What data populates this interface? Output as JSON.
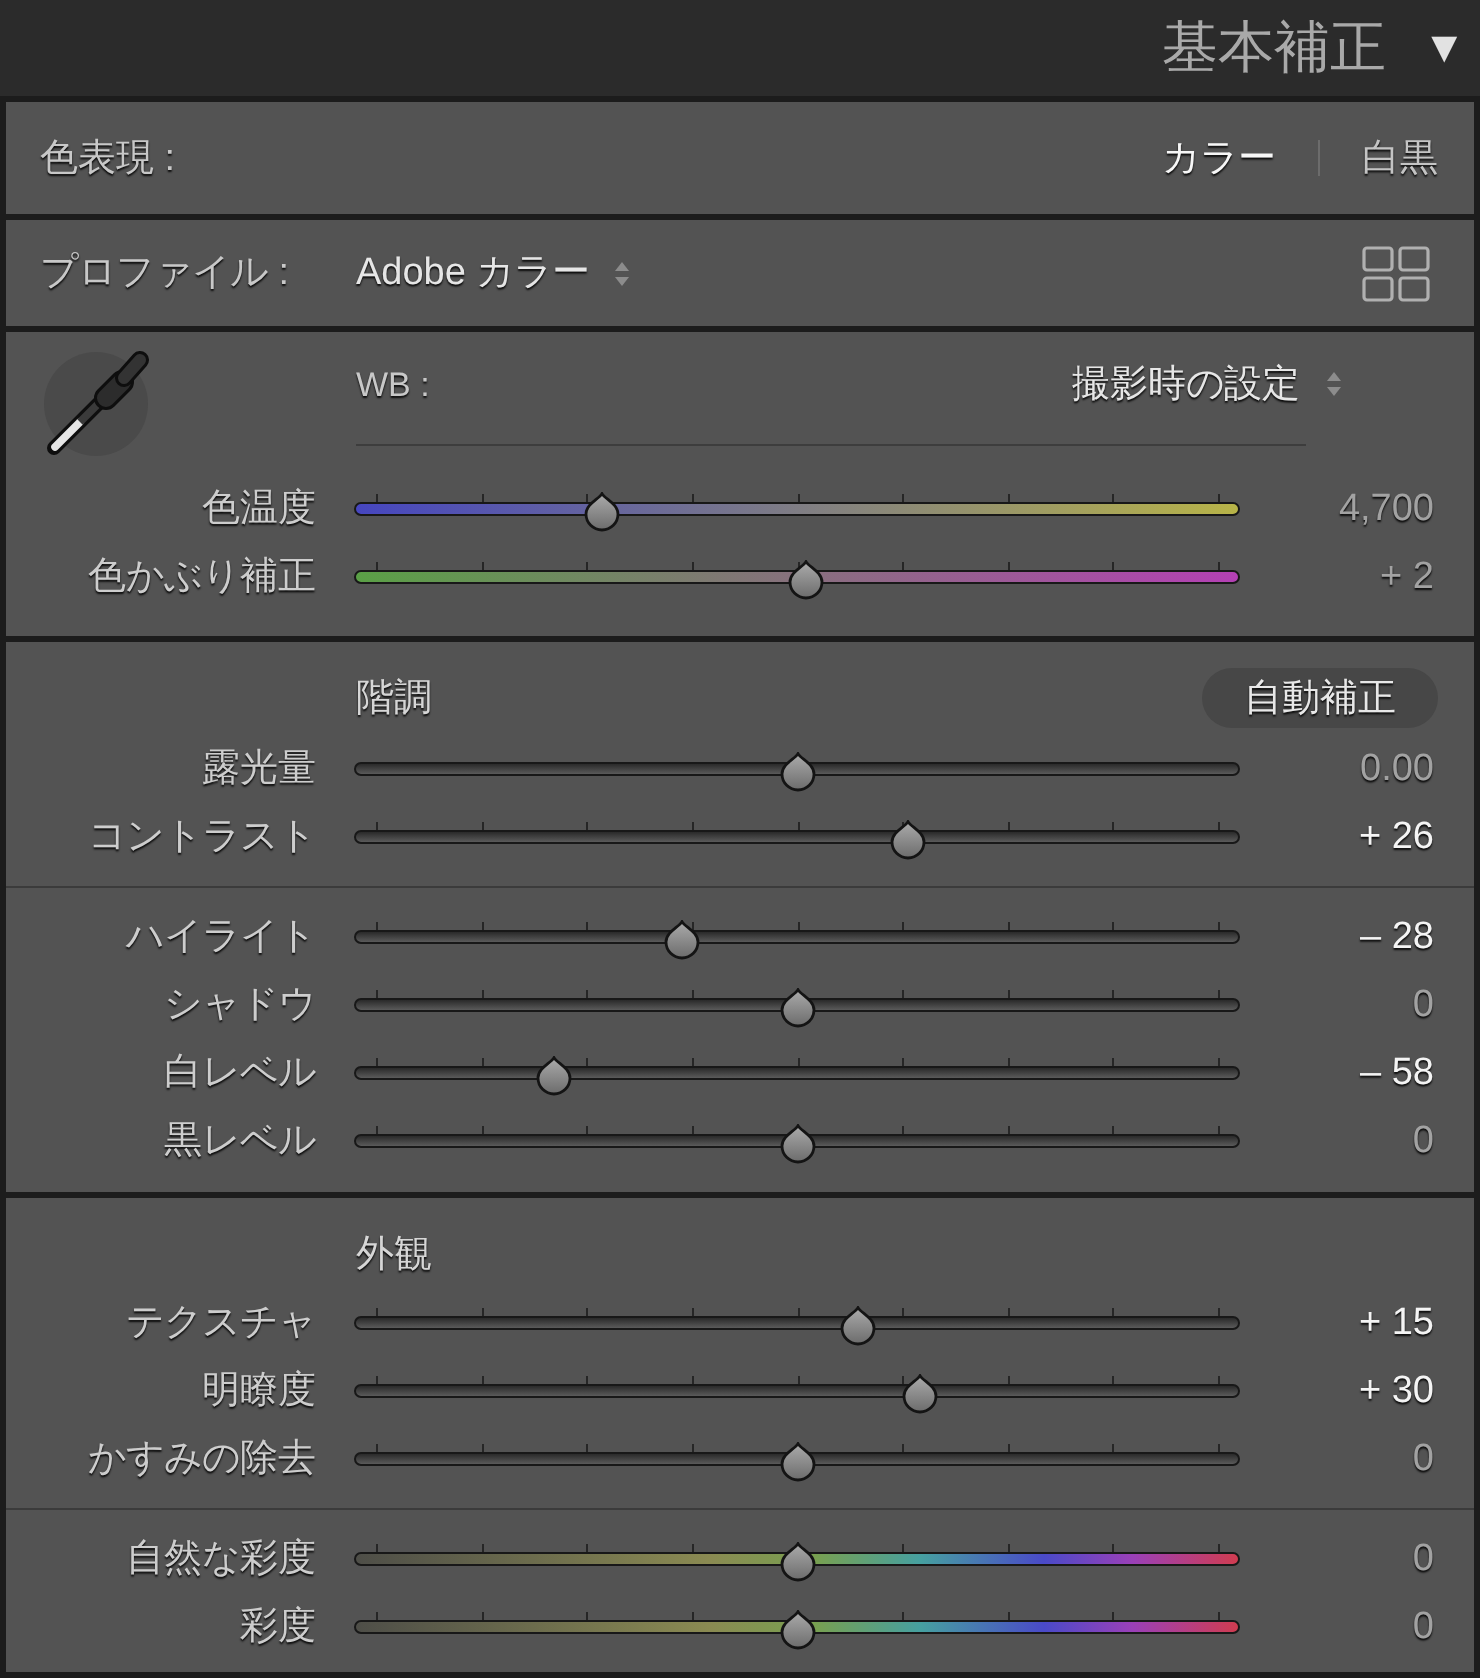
{
  "panel_header": {
    "title": "基本補正",
    "toggle": "▼"
  },
  "treatment": {
    "label": "色表現 :",
    "options": [
      {
        "label": "カラー",
        "selected": true
      },
      {
        "label": "白黒",
        "selected": false
      }
    ]
  },
  "profile": {
    "label": "プロファイル :",
    "value": "Adobe カラー"
  },
  "white_balance": {
    "label": "WB :",
    "value": "撮影時の設定",
    "sliders": [
      {
        "label": "色温度",
        "kind": "temperature",
        "ticks": true,
        "level": 0.28,
        "reading": "4,700",
        "modified": false
      },
      {
        "label": "色かぶり補正",
        "kind": "tint",
        "ticks": true,
        "level": 0.51,
        "reading": "+ 2",
        "modified": false
      }
    ]
  },
  "tone": {
    "title": "階調",
    "auto_button": "自動補正",
    "groups": [
      {
        "sliders": [
          {
            "label": "露光量",
            "kind": "plain",
            "ticks": false,
            "level": 0.5,
            "reading": "0.00",
            "modified": false
          },
          {
            "label": "コントラスト",
            "kind": "plain",
            "ticks": true,
            "level": 0.625,
            "reading": "+ 26",
            "modified": true
          }
        ]
      },
      {
        "sliders": [
          {
            "label": "ハイライト",
            "kind": "plain",
            "ticks": true,
            "level": 0.37,
            "reading": "– 28",
            "modified": true
          },
          {
            "label": "シャドウ",
            "kind": "plain",
            "ticks": true,
            "level": 0.5,
            "reading": "0",
            "modified": false
          },
          {
            "label": "白レベル",
            "kind": "plain",
            "ticks": true,
            "level": 0.225,
            "reading": "– 58",
            "modified": true
          },
          {
            "label": "黒レベル",
            "kind": "plain",
            "ticks": true,
            "level": 0.5,
            "reading": "0",
            "modified": false
          }
        ]
      }
    ]
  },
  "presence": {
    "title": "外観",
    "groups": [
      {
        "sliders": [
          {
            "label": "テクスチャ",
            "kind": "plain",
            "ticks": true,
            "level": 0.57,
            "reading": "+ 15",
            "modified": true
          },
          {
            "label": "明瞭度",
            "kind": "plain",
            "ticks": true,
            "level": 0.64,
            "reading": "+ 30",
            "modified": true
          },
          {
            "label": "かすみの除去",
            "kind": "plain",
            "ticks": true,
            "level": 0.5,
            "reading": "0",
            "modified": false
          }
        ]
      },
      {
        "sliders": [
          {
            "label": "自然な彩度",
            "kind": "saturation",
            "ticks": true,
            "level": 0.5,
            "reading": "0",
            "modified": false
          },
          {
            "label": "彩度",
            "kind": "saturation",
            "ticks": true,
            "level": 0.5,
            "reading": "0",
            "modified": false
          }
        ]
      }
    ]
  }
}
